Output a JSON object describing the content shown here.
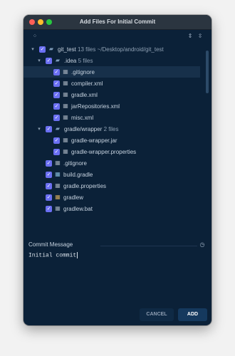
{
  "window": {
    "title": "Add Files For Initial Commit"
  },
  "toolbar": {
    "left_icon": "group-by-icon",
    "right_icons": [
      "expand-all-icon",
      "collapse-all-icon"
    ]
  },
  "tree": {
    "rows": [
      {
        "label": "git_test",
        "meta": "13 files ~/Desktop/android/git_test",
        "type": "folder",
        "expanded": true,
        "checked": true
      },
      {
        "label": ".idea",
        "meta": "5 files",
        "type": "folder",
        "expanded": true,
        "checked": true
      },
      {
        "label": ".gitignore",
        "type": "file",
        "checked": true,
        "selected": true
      },
      {
        "label": "compiler.xml",
        "type": "file",
        "checked": true
      },
      {
        "label": "gradle.xml",
        "type": "file",
        "checked": true
      },
      {
        "label": "jarRepositories.xml",
        "type": "file",
        "checked": true
      },
      {
        "label": "misc.xml",
        "type": "file",
        "checked": true
      },
      {
        "label": "gradle/wrapper",
        "meta": "2 files",
        "type": "folder",
        "expanded": true,
        "checked": true
      },
      {
        "label": "gradle-wrapper.jar",
        "type": "file",
        "checked": true
      },
      {
        "label": "gradle-wrapper.properties",
        "type": "file",
        "checked": true
      },
      {
        "label": ".gitignore",
        "type": "file",
        "checked": true
      },
      {
        "label": "build.gradle",
        "type": "file",
        "checked": true
      },
      {
        "label": "gradle.properties",
        "type": "file",
        "checked": true
      },
      {
        "label": "gradlew",
        "type": "file",
        "checked": true
      },
      {
        "label": "gradlew.bat",
        "type": "file",
        "checked": true
      }
    ]
  },
  "commit": {
    "label": "Commit Message",
    "message": "Initial commit"
  },
  "buttons": {
    "cancel": "CANCEL",
    "add": "ADD"
  },
  "colors": {
    "background": "#0b2138",
    "checkbox": "#6b6ff2",
    "selected_row": "#17304a",
    "primary_button": "#15395e"
  }
}
